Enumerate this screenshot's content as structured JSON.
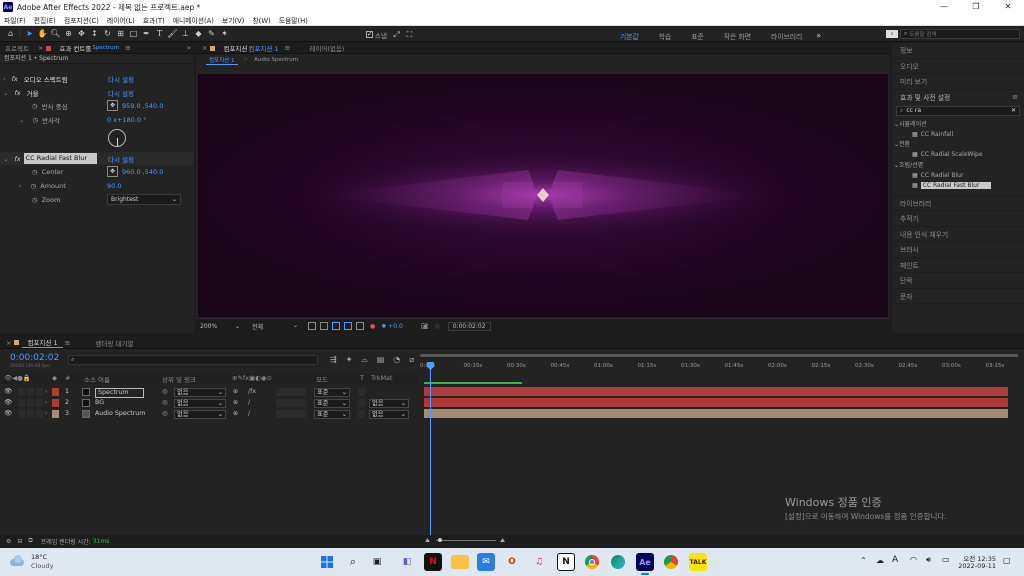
{
  "window": {
    "title": "Adobe After Effects 2022 - 제목 없는 프로젝트.aep *",
    "app_badge": "Ae",
    "minimize": "—",
    "maximize": "❐",
    "close": "✕"
  },
  "menu": [
    "파일(F)",
    "편집(E)",
    "컴포지션(C)",
    "레이어(L)",
    "효과(T)",
    "애니메이션(A)",
    "보기(V)",
    "창(W)",
    "도움말(H)"
  ],
  "toolbar": {
    "snap_label": "스냅",
    "workspaces": [
      "기본값",
      "학습",
      "표준",
      "작은 화면",
      "라이브러리"
    ],
    "search_help_placeholder": "도움말 검색"
  },
  "left_panel": {
    "tabs": {
      "project": "프로젝트",
      "effects_controls": "효과 컨트롤",
      "effects_target": "Spectrum"
    },
    "breadcrumb": "컴포지션 1 • Spectrum",
    "effects": [
      {
        "name": "오디오 스펙트럼",
        "reset": "다시 설정"
      },
      {
        "name": "거울",
        "reset": "다시 설정",
        "props": [
          {
            "name": "반사 중심",
            "value": "959.0 ,540.0"
          },
          {
            "name": "반사각",
            "value": "0 x+180.0 °"
          }
        ]
      },
      {
        "name": "CC Radial Fast Blur",
        "reset": "다시 설정",
        "props": [
          {
            "name": "Center",
            "value": "960.0 ,540.0"
          },
          {
            "name": "Amount",
            "value": "90.0"
          },
          {
            "name": "Zoom",
            "value": "Brightest"
          }
        ]
      }
    ]
  },
  "viewer": {
    "tabs": {
      "comp": "컴포지션",
      "comp_name": "컴포지션 1",
      "layer": "레이어(없음)"
    },
    "subtabs": [
      "컴포지션 1",
      "Audio Spectrum"
    ],
    "zoom": "200%",
    "resolution": "전체",
    "exposure": "+0.0",
    "timecode": "0:00:02:02"
  },
  "right_panel": {
    "top_items": [
      "정보",
      "오디오",
      "미리 보기"
    ],
    "effects_header": "효과 및 사전 설정",
    "search_value": "cc ra",
    "tree": [
      {
        "category": "시뮬레이션",
        "items": [
          "CC Rainfall"
        ]
      },
      {
        "category": "전환",
        "items": [
          "CC Radial ScaleWipe"
        ]
      },
      {
        "category": "흐림/선명",
        "items": [
          "CC Radial Blur",
          "CC Radial Fast Blur"
        ]
      }
    ],
    "bottom_items": [
      "라이브러리",
      "추적기",
      "내용 인식 채우기",
      "브러시",
      "페인트",
      "단락",
      "문자"
    ]
  },
  "timeline": {
    "tabs": {
      "comp": "컴포지션 1",
      "render_queue": "렌더링 대기열"
    },
    "timecode": "0:00:02:02",
    "frames_sub": "00062 (30.00 fps)",
    "columns": {
      "source": "소스 이름",
      "parent": "상위 및 링크",
      "mode": "모드",
      "trkmat": "TrkMat",
      "t": "T",
      "num": "#"
    },
    "ruler": [
      "0:00s",
      "00:15s",
      "00:30s",
      "00:45s",
      "01:00s",
      "01:15s",
      "01:30s",
      "01:45s",
      "02:00s",
      "02:15s",
      "02:30s",
      "02:45s",
      "03:00s",
      "03:15s"
    ],
    "layers": [
      {
        "num": "1",
        "name": "Spectrum",
        "color": "#b03a3a",
        "parent": "없음",
        "mode": "표준",
        "trkmat": ""
      },
      {
        "num": "2",
        "name": "BG",
        "color": "#b03a3a",
        "parent": "없음",
        "mode": "표준",
        "trkmat": "없음"
      },
      {
        "num": "3",
        "name": "Audio Spectrum",
        "color": "#a38b74",
        "parent": "없음",
        "mode": "표준",
        "trkmat": "없음"
      }
    ],
    "frame_render_time_label": "프레임 렌더링 시간:",
    "frame_render_time": "31ms"
  },
  "watermark": {
    "title": "Windows 정품 인증",
    "subtitle": "[설정]으로 이동하여 Windows를 정품 인증합니다."
  },
  "taskbar": {
    "temp": "18°C",
    "weather": "Cloudy",
    "time": "오전 12:35",
    "date": "2022-09-11",
    "ime": "A"
  },
  "colors": {
    "accent": "#4b9cff",
    "bg_dark": "#1d1d1d",
    "panel": "#232323",
    "layer_red": "#b03a3a",
    "layer_tan": "#a38b74"
  }
}
